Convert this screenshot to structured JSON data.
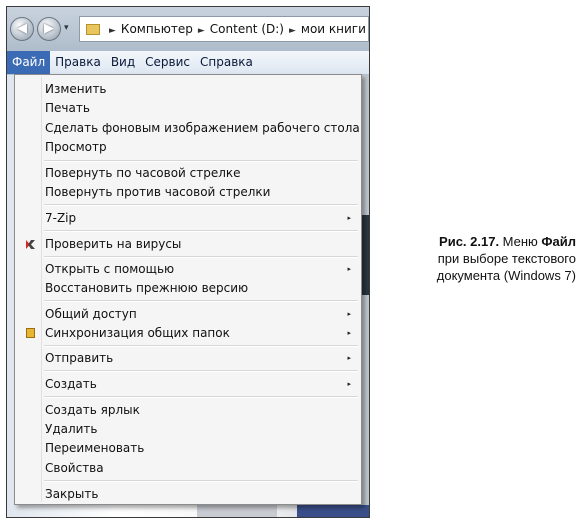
{
  "address_bar": {
    "back_icon": "back-arrow-icon",
    "forward_icon": "forward-arrow-icon",
    "breadcrumbs": [
      "Компьютер",
      "Content (D:)",
      "мои книги"
    ]
  },
  "menubar": {
    "items": [
      "Файл",
      "Правка",
      "Вид",
      "Сервис",
      "Справка"
    ]
  },
  "file_menu": {
    "items": [
      "Изменить",
      "Печать",
      "Сделать фоновым изображением рабочего стола",
      "Просмотр",
      "Повернуть по часовой стрелке",
      "Повернуть против часовой стрелки",
      "7-Zip",
      "Проверить на вирусы",
      "Открыть с помощью",
      "Восстановить прежнюю версию",
      "Общий доступ",
      "Синхронизация общих папок",
      "Отправить",
      "Создать",
      "Создать ярлык",
      "Удалить",
      "Переименовать",
      "Свойства",
      "Закрыть"
    ],
    "submenu_arrow": "▸"
  },
  "caption": {
    "label": "Рис. 2.17.",
    "text1": " Меню ",
    "menu_name": "Файл",
    "line2": "при выборе текстового",
    "line3": "документа (Windows 7)"
  },
  "colors": {
    "menu_active": "#3b6bb5",
    "menu_bg": "#f5f5f5"
  }
}
